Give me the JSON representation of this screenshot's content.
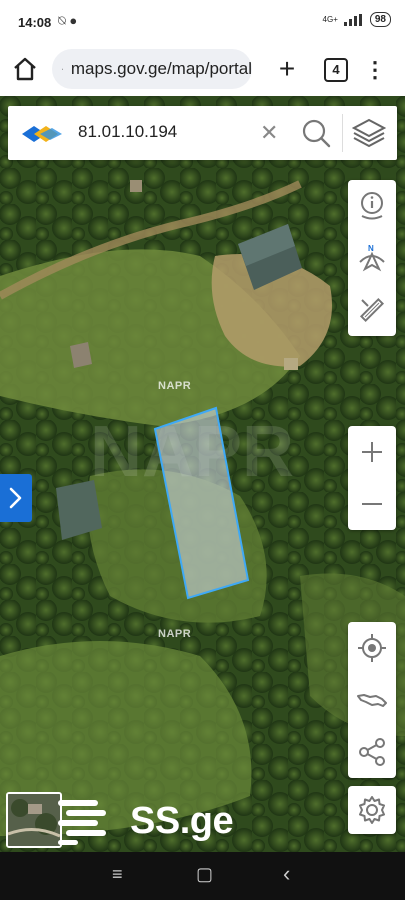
{
  "status_bar": {
    "time": "14:08",
    "status_icons": "⍉ ●",
    "signal_text": "4G+",
    "battery": "98"
  },
  "browser": {
    "url": "maps.gov.ge/map/portal",
    "tab_count": "4",
    "new_tab_symbol": "+",
    "menu_symbol": "⋮"
  },
  "map": {
    "search_query": "81.01.10.194",
    "clear_symbol": "✕",
    "napr_label_1": "NAPR",
    "napr_label_2": "NAPR",
    "watermark_brand": "SS.ge",
    "parcel_fill": "#c9d3dc",
    "parcel_stroke": "#3fa9f5",
    "side_panel_color": "#1a6fd6",
    "tool_icons": [
      "info-location-icon",
      "compass-north-icon",
      "measure-ruler-icon",
      "zoom-in-icon",
      "zoom-out-icon",
      "my-location-icon",
      "georgia-map-icon",
      "share-icon",
      "settings-gear-icon"
    ]
  },
  "nav_bar": {
    "menu_symbol": "≡",
    "home_symbol": "▢",
    "back_symbol": "‹"
  }
}
